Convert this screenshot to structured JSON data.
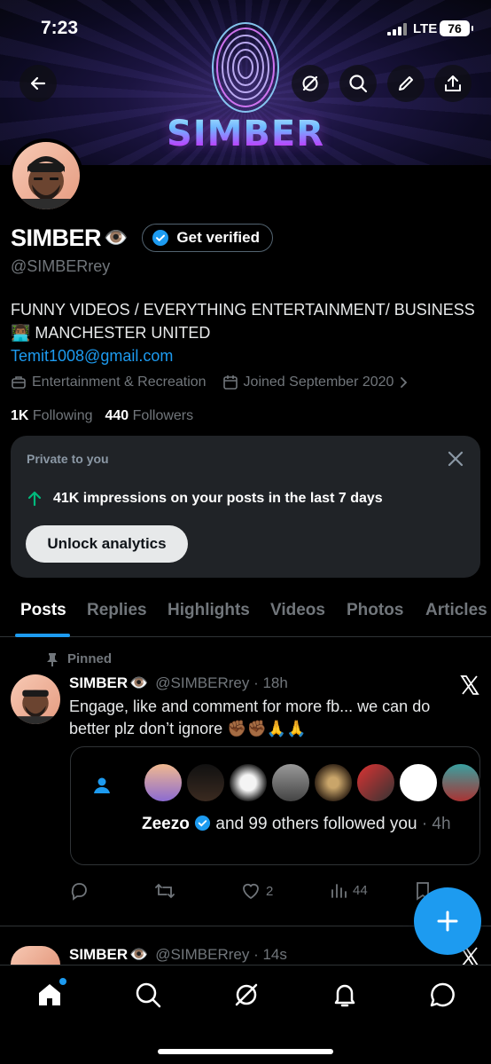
{
  "status_bar": {
    "time": "7:23",
    "network": "LTE",
    "battery": "76"
  },
  "banner": {
    "logo_text": "SIMBER"
  },
  "profile": {
    "display_name": "SIMBER",
    "name_emoji": "👁️",
    "verify_label": "Get verified",
    "handle": "@SIMBERrey",
    "bio_line1": "FUNNY VIDEOS / EVERYTHING ENTERTAINMENT/ BUSINESS",
    "bio_line2": "👨🏾‍💻 MANCHESTER UNITED",
    "email": "Temit1008@gmail.com",
    "category": "Entertainment & Recreation",
    "joined": "Joined September 2020",
    "following_count": "1K",
    "following_label": "Following",
    "followers_count": "440",
    "followers_label": "Followers"
  },
  "analytics_card": {
    "private_label": "Private to you",
    "impressions_text": "41K impressions on your posts in the last 7 days",
    "unlock_label": "Unlock analytics"
  },
  "tabs": [
    "Posts",
    "Replies",
    "Highlights",
    "Videos",
    "Photos",
    "Articles"
  ],
  "active_tab": "Posts",
  "pinned_post": {
    "pinned_label": "Pinned",
    "name": "SIMBER",
    "name_emoji": "👁️",
    "handle_time": "@SIMBERrey · 18h",
    "text": "Engage, like and comment for more fb... we can do better plz don’t ignore ✊🏾✊🏾🙏🙏",
    "embed": {
      "bold_name": "Zeezo",
      "rest": " and 99 others followed you",
      "time": "· 4h"
    },
    "likes": "2",
    "views": "44"
  },
  "next_post": {
    "name": "SIMBER",
    "name_emoji": "👁️",
    "handle_time": "@SIMBERrey · 14s"
  },
  "colors": {
    "accent": "#1d9bf0",
    "background": "#000000",
    "card": "#202327",
    "muted": "#71767b",
    "up_arrow": "#00ba7c"
  }
}
